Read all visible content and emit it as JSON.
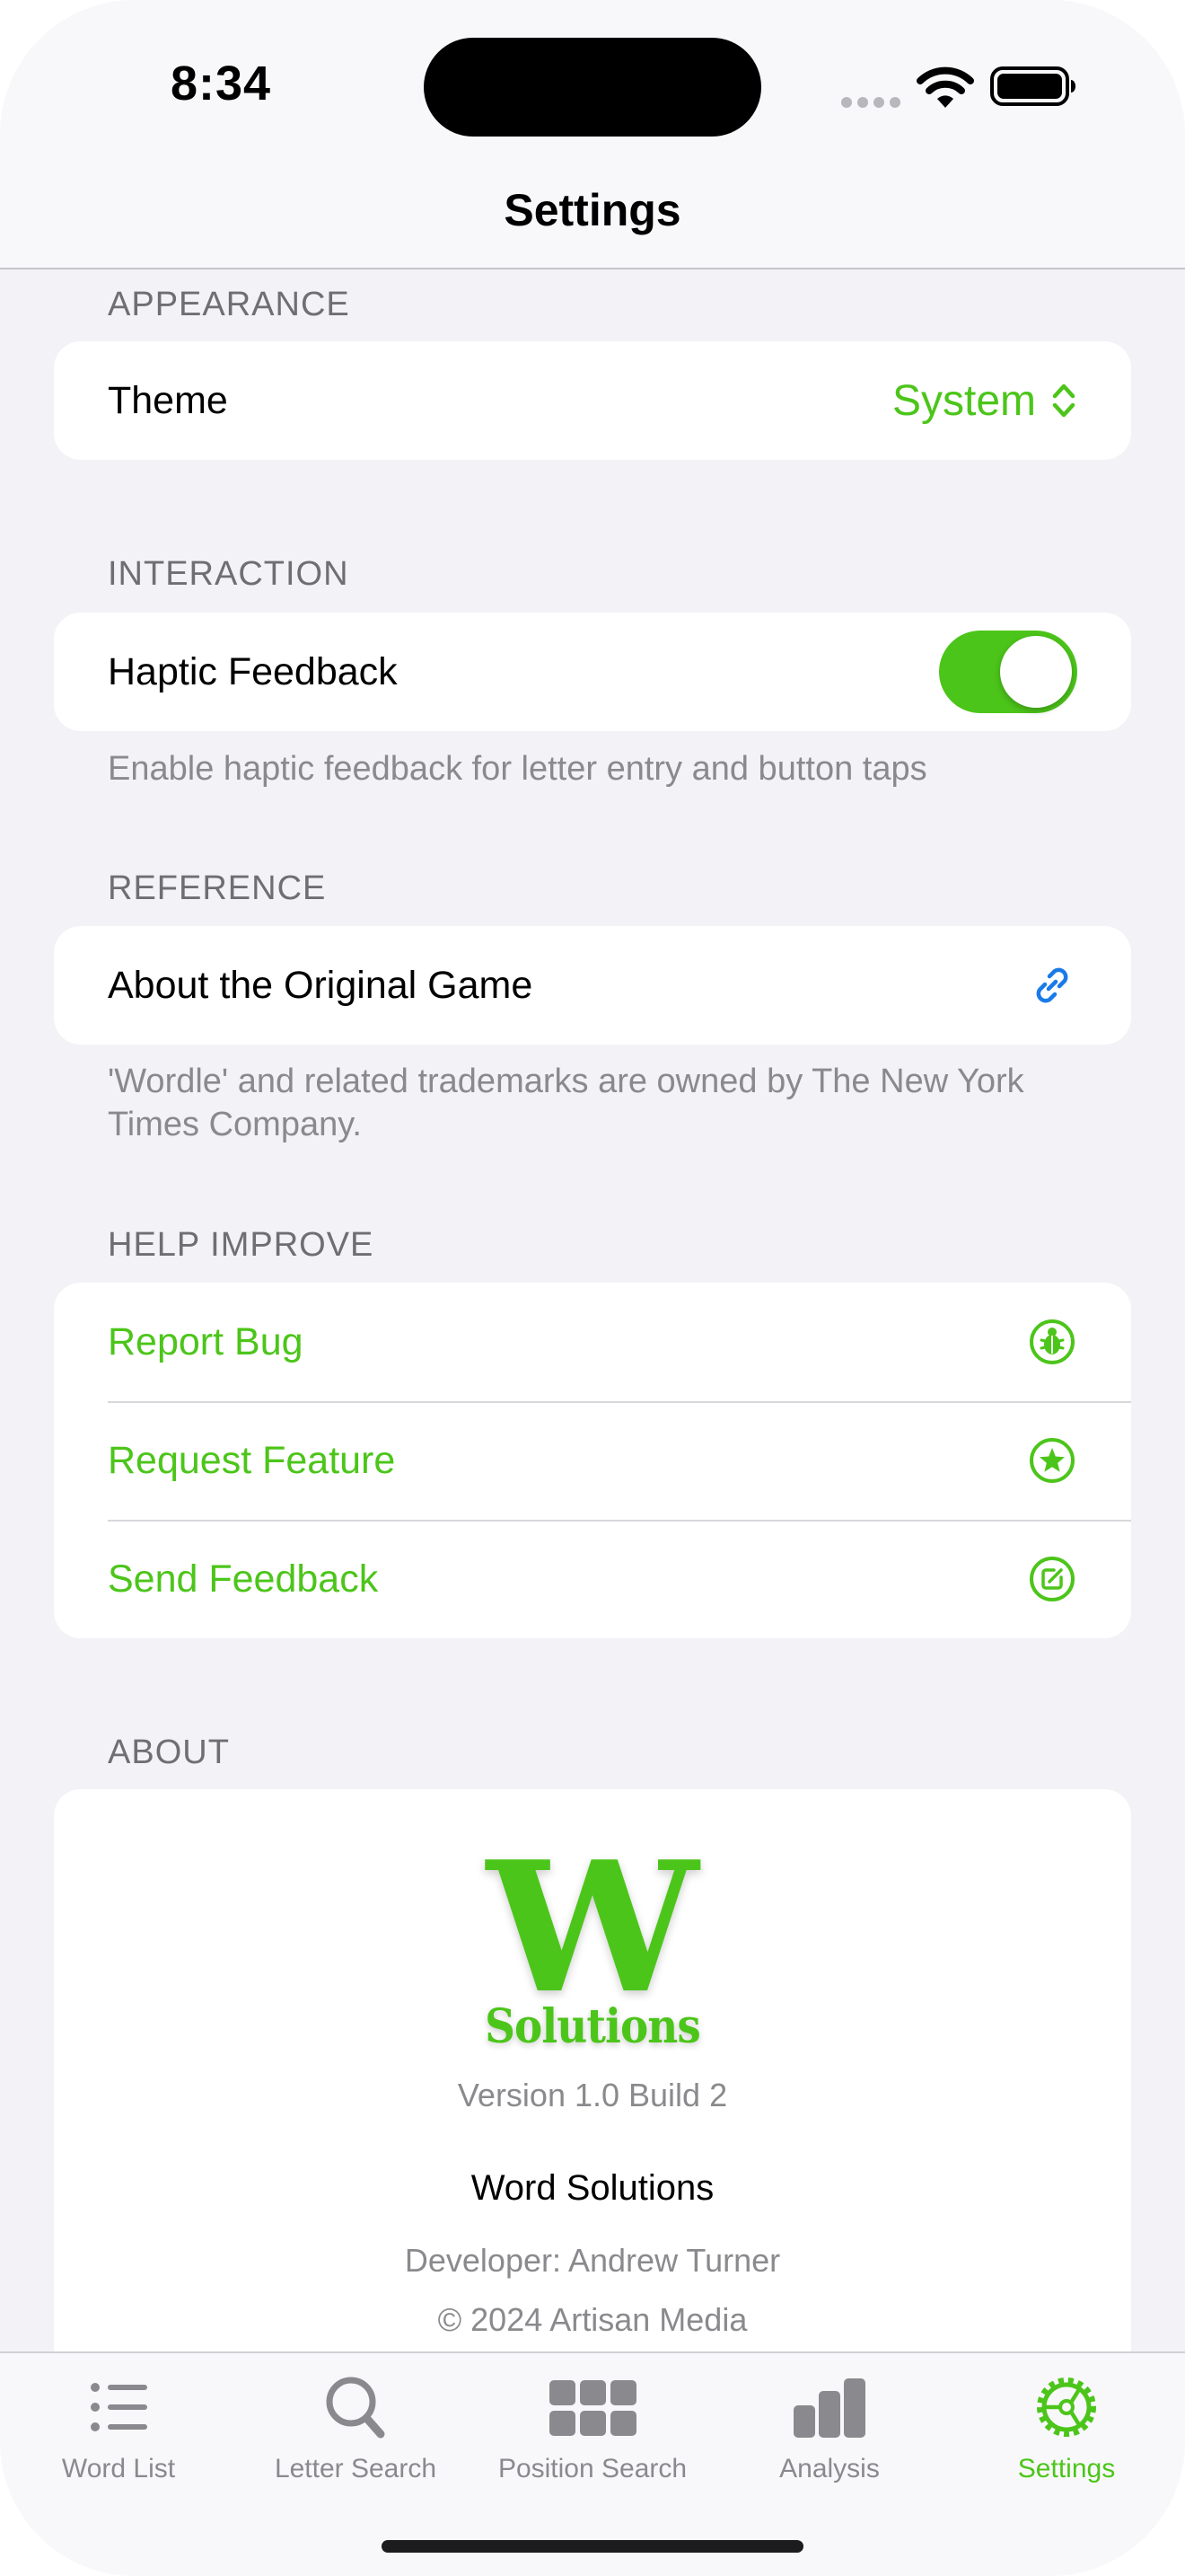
{
  "status": {
    "time": "8:34"
  },
  "nav": {
    "title": "Settings"
  },
  "appearance": {
    "header": "APPEARANCE",
    "theme_label": "Theme",
    "theme_value": "System"
  },
  "interaction": {
    "header": "INTERACTION",
    "haptic_label": "Haptic Feedback",
    "haptic_enabled": true,
    "footer": "Enable haptic feedback for letter entry and button taps"
  },
  "reference": {
    "header": "REFERENCE",
    "about_game_label": "About the Original Game",
    "footer": "'Wordle' and related trademarks are owned by The New York Times Company."
  },
  "help": {
    "header": "HELP IMPROVE",
    "items": [
      {
        "label": "Report Bug",
        "icon": "ladybug-icon"
      },
      {
        "label": "Request Feature",
        "icon": "star-circle-icon"
      },
      {
        "label": "Send Feedback",
        "icon": "compose-icon"
      }
    ]
  },
  "about": {
    "header": "ABOUT",
    "logo_letter": "W",
    "logo_subtitle": "Solutions",
    "version": "Version 1.0 Build 2",
    "app_name": "Word Solutions",
    "developer": "Developer: Andrew Turner",
    "copyright": "© 2024 Artisan Media"
  },
  "tabs": [
    {
      "label": "Word List",
      "icon": "list-icon"
    },
    {
      "label": "Letter Search",
      "icon": "magnifier-icon"
    },
    {
      "label": "Position Search",
      "icon": "grid-icon"
    },
    {
      "label": "Analysis",
      "icon": "bar-chart-icon"
    },
    {
      "label": "Settings",
      "icon": "gear-icon",
      "active": true
    }
  ],
  "colors": {
    "accent": "#4cc51a",
    "link": "#1a7be8",
    "background": "#f2f2f7"
  }
}
